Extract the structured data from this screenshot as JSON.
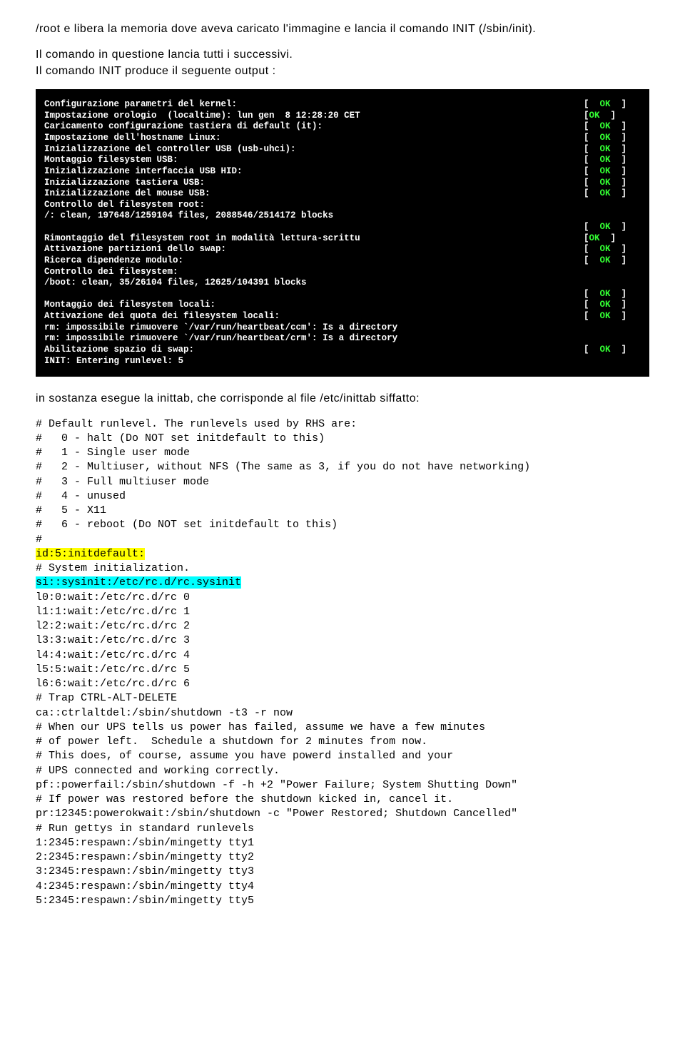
{
  "intro": {
    "line1": "/root e libera la memoria dove aveva caricato l'immagine e lancia il comando INIT (/sbin/init).",
    "line2": "Il comando in questione lancia tutti i successivi.",
    "line3": "Il comando INIT produce il seguente output :"
  },
  "console": {
    "ok": "OK",
    "rows": [
      {
        "text": "Configurazione parametri del kernel:",
        "ok": true
      },
      {
        "text": "Impostazione orologio  (localtime): lun gen  8 12:28:20 CET",
        "ok": true,
        "nobracket": true
      },
      {
        "text": "Caricamento configurazione tastiera di default (it):",
        "ok": true
      },
      {
        "text": "Impostazione dell'hostname Linux:",
        "ok": true
      },
      {
        "text": "Inizializzazione del controller USB (usb-uhci):",
        "ok": true
      },
      {
        "text": "Montaggio filesystem USB:",
        "ok": true
      },
      {
        "text": "Inizializzazione interfaccia USB HID:",
        "ok": true
      },
      {
        "text": "Inizializzazione tastiera USB:",
        "ok": true
      },
      {
        "text": "Inizializzazione del mouse USB:",
        "ok": true
      },
      {
        "text": "Controllo del filesystem root:",
        "ok": false
      },
      {
        "text": "/: clean, 197648/1259104 files, 2088546/2514172 blocks",
        "ok": false
      },
      {
        "text": "",
        "ok": true
      },
      {
        "text": "Rimontaggio del filesystem root in modalità lettura-scrittu",
        "ok": true,
        "nobracket": true
      },
      {
        "text": "Attivazione partizioni dello swap:",
        "ok": true
      },
      {
        "text": "Ricerca dipendenze modulo:",
        "ok": true
      },
      {
        "text": "Controllo dei filesystem:",
        "ok": false
      },
      {
        "text": "/boot: clean, 35/26104 files, 12625/104391 blocks",
        "ok": false
      },
      {
        "text": "",
        "ok": true
      },
      {
        "text": "Montaggio dei filesystem locali:",
        "ok": true
      },
      {
        "text": "Attivazione dei quota dei filesystem locali:",
        "ok": true
      },
      {
        "text": "rm: impossibile rimuovere `/var/run/heartbeat/ccm': Is a directory",
        "ok": false
      },
      {
        "text": "rm: impossibile rimuovere `/var/run/heartbeat/crm': Is a directory",
        "ok": false
      },
      {
        "text": "Abilitazione spazio di swap:",
        "ok": true
      },
      {
        "text": "INIT: Entering runlevel: 5",
        "ok": false
      }
    ]
  },
  "after_console": "in sostanza esegue la inittab, che corrisponde al file /etc/inittab siffatto:",
  "code": {
    "lines": [
      {
        "t": "# Default runlevel. The runlevels used by RHS are:"
      },
      {
        "t": "#   0 - halt (Do NOT set initdefault to this)"
      },
      {
        "t": "#   1 - Single user mode"
      },
      {
        "t": "#   2 - Multiuser, without NFS (The same as 3, if you do not have networking)"
      },
      {
        "t": "#   3 - Full multiuser mode"
      },
      {
        "t": "#   4 - unused"
      },
      {
        "t": "#   5 - X11"
      },
      {
        "t": "#   6 - reboot (Do NOT set initdefault to this)"
      },
      {
        "t": "#"
      },
      {
        "t": "id:5:initdefault:",
        "hl": "yellow"
      },
      {
        "t": "# System initialization."
      },
      {
        "t": "si::sysinit:/etc/rc.d/rc.sysinit",
        "hl": "cyan"
      },
      {
        "t": "l0:0:wait:/etc/rc.d/rc 0"
      },
      {
        "t": "l1:1:wait:/etc/rc.d/rc 1"
      },
      {
        "t": "l2:2:wait:/etc/rc.d/rc 2"
      },
      {
        "t": "l3:3:wait:/etc/rc.d/rc 3"
      },
      {
        "t": "l4:4:wait:/etc/rc.d/rc 4"
      },
      {
        "t": "l5:5:wait:/etc/rc.d/rc 5"
      },
      {
        "t": "l6:6:wait:/etc/rc.d/rc 6"
      },
      {
        "t": "# Trap CTRL-ALT-DELETE"
      },
      {
        "t": "ca::ctrlaltdel:/sbin/shutdown -t3 -r now"
      },
      {
        "t": "# When our UPS tells us power has failed, assume we have a few minutes"
      },
      {
        "t": "# of power left.  Schedule a shutdown for 2 minutes from now."
      },
      {
        "t": "# This does, of course, assume you have powerd installed and your"
      },
      {
        "t": "# UPS connected and working correctly."
      },
      {
        "t": "pf::powerfail:/sbin/shutdown -f -h +2 \"Power Failure; System Shutting Down\""
      },
      {
        "t": "# If power was restored before the shutdown kicked in, cancel it."
      },
      {
        "t": "pr:12345:powerokwait:/sbin/shutdown -c \"Power Restored; Shutdown Cancelled\""
      },
      {
        "t": "# Run gettys in standard runlevels"
      },
      {
        "t": "1:2345:respawn:/sbin/mingetty tty1"
      },
      {
        "t": "2:2345:respawn:/sbin/mingetty tty2"
      },
      {
        "t": "3:2345:respawn:/sbin/mingetty tty3"
      },
      {
        "t": "4:2345:respawn:/sbin/mingetty tty4"
      },
      {
        "t": "5:2345:respawn:/sbin/mingetty tty5"
      }
    ]
  }
}
